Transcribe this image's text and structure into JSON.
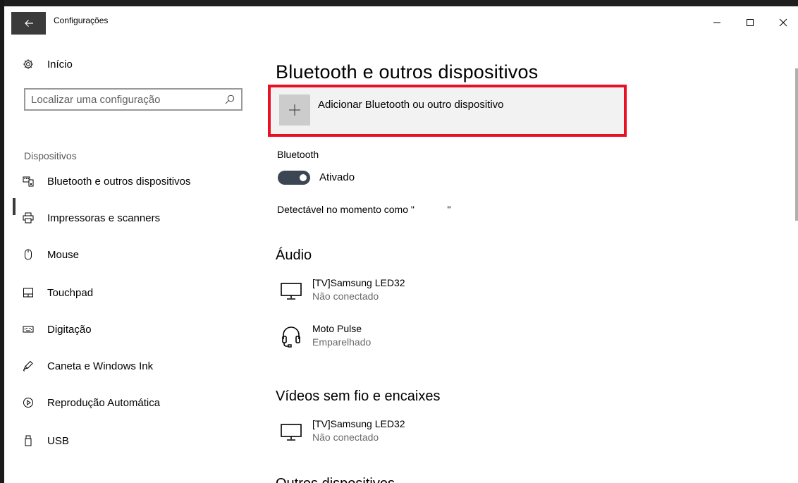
{
  "window": {
    "title": "Configurações"
  },
  "sidebar": {
    "home_label": "Início",
    "search_placeholder": "Localizar uma configuração",
    "section": "Dispositivos",
    "items": [
      {
        "label": "Bluetooth e outros dispositivos",
        "icon": "bluetooth-devices-icon",
        "selected": true
      },
      {
        "label": "Impressoras e scanners",
        "icon": "printer-icon"
      },
      {
        "label": "Mouse",
        "icon": "mouse-icon"
      },
      {
        "label": "Touchpad",
        "icon": "touchpad-icon"
      },
      {
        "label": "Digitação",
        "icon": "keyboard-icon"
      },
      {
        "label": "Caneta e Windows Ink",
        "icon": "pen-icon"
      },
      {
        "label": "Reprodução Automática",
        "icon": "autoplay-icon"
      },
      {
        "label": "USB",
        "icon": "usb-icon"
      }
    ]
  },
  "main": {
    "title": "Bluetooth e outros dispositivos",
    "add_device_label": "Adicionar Bluetooth ou outro dispositivo",
    "bluetooth_label": "Bluetooth",
    "bluetooth_state": "Ativado",
    "discoverable_text": "Detectável no momento como \"            \"",
    "audio_heading": "Áudio",
    "audio_devices": [
      {
        "name": "[TV]Samsung LED32",
        "status": "Não conectado",
        "icon": "monitor-icon"
      },
      {
        "name": "Moto Pulse",
        "status": "Emparelhado",
        "icon": "headset-icon"
      }
    ],
    "wireless_heading": "Vídeos sem fio e encaixes",
    "wireless_devices": [
      {
        "name": "[TV]Samsung LED32",
        "status": "Não conectado",
        "icon": "monitor-icon"
      }
    ],
    "other_heading": "Outros dispositivos"
  },
  "colors": {
    "accent_highlight": "#e81123",
    "toggle_on": "#3c4652"
  }
}
